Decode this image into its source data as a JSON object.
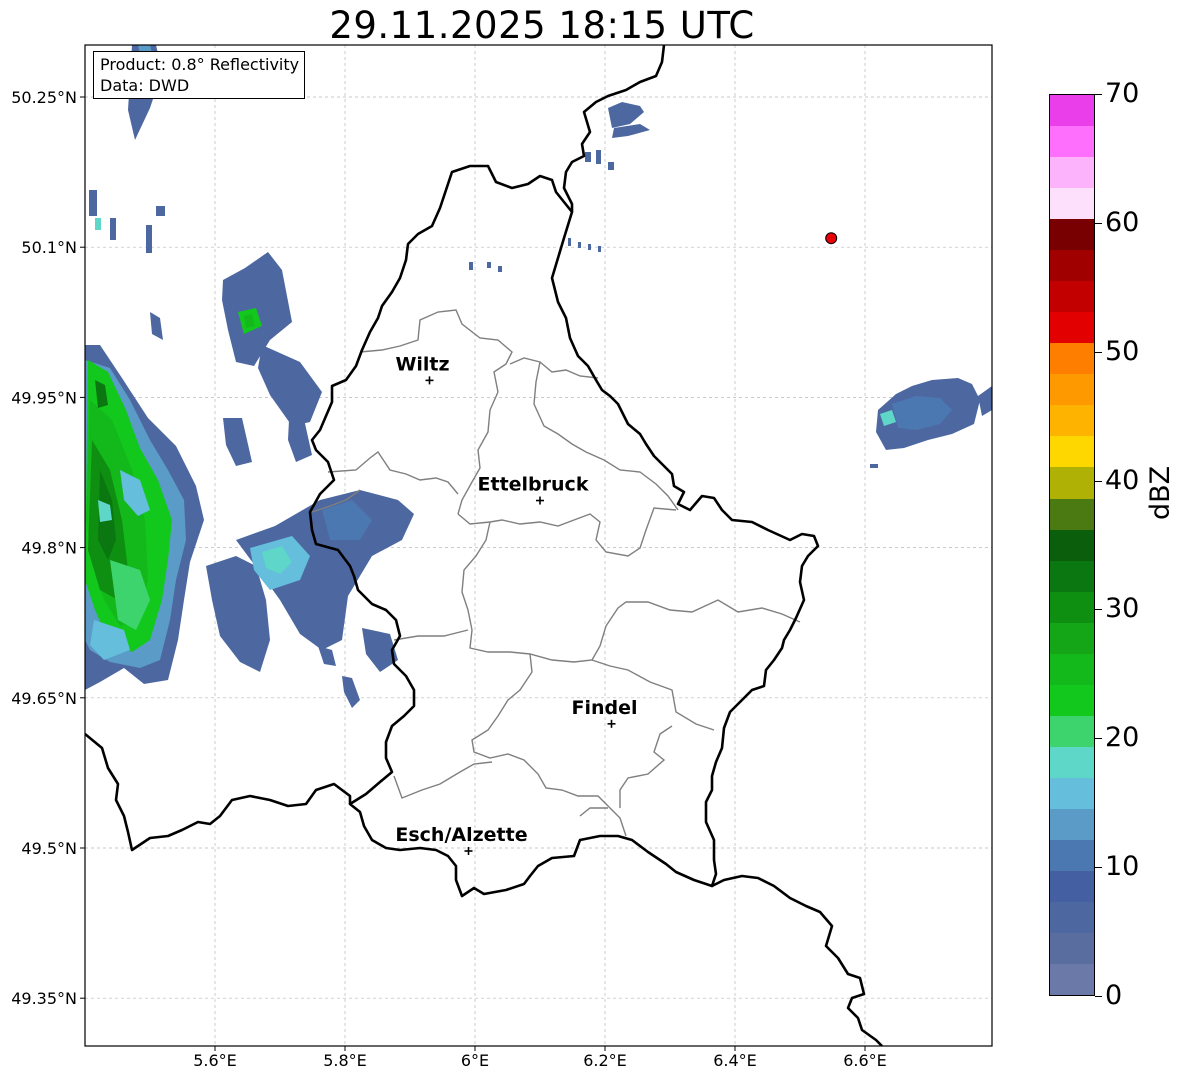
{
  "title": "29.11.2025 18:15 UTC",
  "info": {
    "product": "Product: 0.8° Reflectivity",
    "data": "Data: DWD"
  },
  "latitude_labels": [
    {
      "lat": 50.25,
      "text": "50.25°N"
    },
    {
      "lat": 50.1,
      "text": "50.1°N"
    },
    {
      "lat": 49.95,
      "text": "49.95°N"
    },
    {
      "lat": 49.8,
      "text": "49.8°N"
    },
    {
      "lat": 49.65,
      "text": "49.65°N"
    },
    {
      "lat": 49.5,
      "text": "49.5°N"
    },
    {
      "lat": 49.35,
      "text": "49.35°N"
    }
  ],
  "longitude_labels": [
    {
      "lon": 5.6,
      "text": "5.6°E"
    },
    {
      "lon": 5.8,
      "text": "5.8°E"
    },
    {
      "lon": 6.0,
      "text": "6°E"
    },
    {
      "lon": 6.2,
      "text": "6.2°E"
    },
    {
      "lon": 6.4,
      "text": "6.4°E"
    },
    {
      "lon": 6.6,
      "text": "6.6°E"
    }
  ],
  "extent": {
    "lon_min": 5.4,
    "lon_max": 6.8,
    "lat_min": 49.3,
    "lat_max": 50.3
  },
  "cities": [
    {
      "name": "Wiltz",
      "lon": 5.93,
      "lat": 49.967
    },
    {
      "name": "Ettelbruck",
      "lon": 6.1,
      "lat": 49.847
    },
    {
      "name": "Findel",
      "lon": 6.21,
      "lat": 49.624
    },
    {
      "name": "Esch/Alzette",
      "lon": 5.99,
      "lat": 49.497
    }
  ],
  "radar_site": {
    "lon": 6.548,
    "lat": 50.109,
    "color": "#e8000b"
  },
  "colorbar": {
    "unit": "dBZ",
    "min": 0,
    "max": 70,
    "ticks": [
      {
        "value": 0,
        "text": "0"
      },
      {
        "value": 10,
        "text": "10"
      },
      {
        "value": 20,
        "text": "20"
      },
      {
        "value": 30,
        "text": "30"
      },
      {
        "value": 40,
        "text": "40"
      },
      {
        "value": 50,
        "text": "50"
      },
      {
        "value": 60,
        "text": "60"
      },
      {
        "value": 70,
        "text": "70"
      }
    ],
    "colors": [
      "#6a79a8",
      "#596e9f",
      "#4d67a0",
      "#4460a3",
      "#4b78b1",
      "#5a9bc8",
      "#64bedc",
      "#5ed6c8",
      "#3dd46e",
      "#13c81d",
      "#13b81a",
      "#14a616",
      "#0f8f11",
      "#0b7710",
      "#0b5e0b",
      "#4b7a12",
      "#afb204",
      "#fed700",
      "#feb300",
      "#fe9900",
      "#fe7f00",
      "#e20000",
      "#c30000",
      "#a00000",
      "#780000",
      "#fde0fc",
      "#fdb3fc",
      "#fd6ffc",
      "#ea3eea"
    ]
  }
}
